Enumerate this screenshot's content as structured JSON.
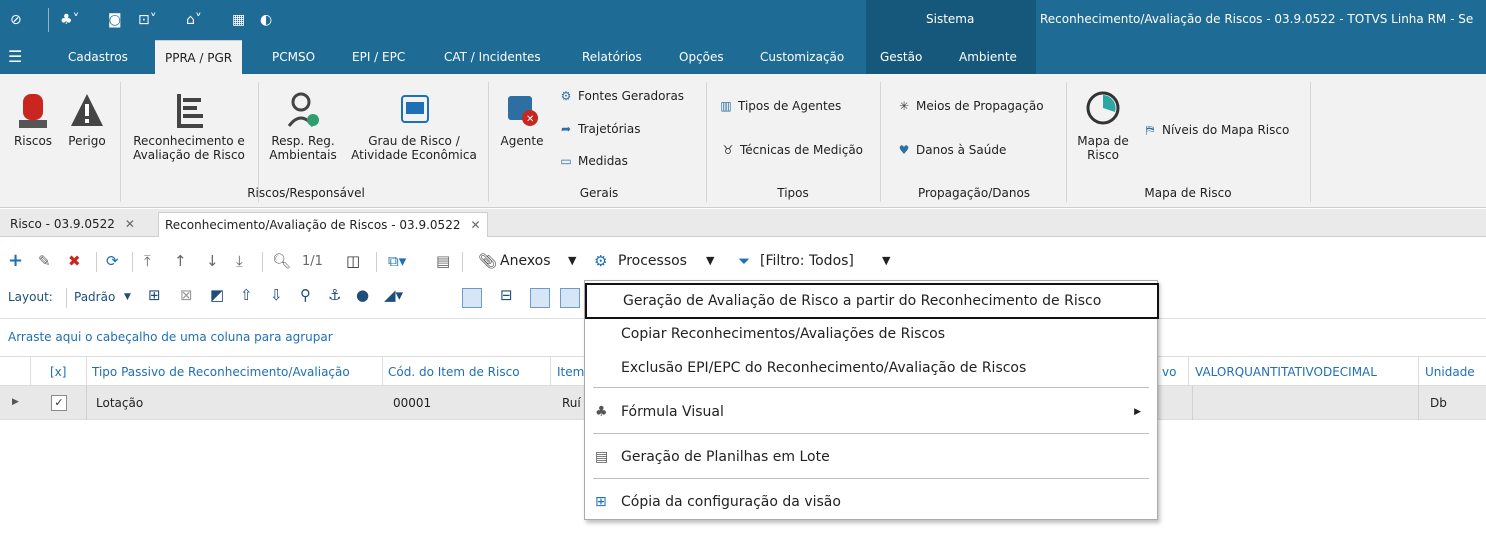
{
  "title_bar": {
    "sistema_label": "Sistema",
    "app_title": "Reconhecimento/Avaliação de Riscos - 03.9.0522 - TOTVS Linha RM - Se"
  },
  "menu": {
    "tabs": [
      "Cadastros",
      "PPRA / PGR",
      "PCMSO",
      "EPI / EPC",
      "CAT / Incidentes",
      "Relatórios",
      "Opções",
      "Customização",
      "Gestão",
      "Ambiente"
    ],
    "active": "PPRA / PGR"
  },
  "ribbon": {
    "riscos": "Riscos",
    "perigo": "Perigo",
    "reconhecimento_1": "Reconhecimento e",
    "reconhecimento_2": "Avaliação de Risco",
    "resp_1": "Resp. Reg.",
    "resp_2": "Ambientais",
    "grau_1": "Grau de Risco /",
    "grau_2": "Atividade Econômica",
    "group_riscos": "Riscos/Responsável",
    "agente": "Agente",
    "fontes": "Fontes Geradoras",
    "trajetorias": "Trajetórias",
    "medidas": "Medidas",
    "group_gerais": "Gerais",
    "tipos_agentes": "Tipos de Agentes",
    "tecnicas": "Técnicas de Medição",
    "group_tipos": "Tipos",
    "meios": "Meios de Propagação",
    "danos": "Danos à Saúde",
    "group_propagacao": "Propagação/Danos",
    "mapa_1": "Mapa de",
    "mapa_2": "Risco",
    "niveis": "Níveis do Mapa Risco",
    "group_mapa": "Mapa de Risco"
  },
  "doc_tabs": {
    "tab1": "Risco - 03.9.0522",
    "tab2": "Reconhecimento/Avaliação de Riscos - 03.9.0522"
  },
  "toolbar": {
    "page": "1/1",
    "anexos": "Anexos",
    "processos": "Processos",
    "filtro": "[Filtro: Todos]",
    "layout": "Layout:",
    "padrao": "Padrão"
  },
  "group_hint": "Arraste aqui o cabeçalho de uma coluna para agrupar",
  "grid": {
    "headers": {
      "check": "[x]",
      "tipo": "Tipo Passivo de Reconhecimento/Avaliação",
      "cod": "Cód. do Item de Risco",
      "item": "Item",
      "partial": "vo",
      "valor": "VALORQUANTITATIVODECIMAL",
      "unidade": "Unidade"
    },
    "row": {
      "tipo": "Lotação",
      "cod": "00001",
      "item": "Ruí",
      "unidade": "Db"
    }
  },
  "processos_menu": {
    "item1": "Geração de Avaliação de Risco a partir do Reconhecimento de Risco",
    "item2": "Copiar Reconhecimentos/Avaliações de Riscos",
    "item3": "Exclusão EPI/EPC do Reconhecimento/Avaliação de Riscos",
    "item4": "Fórmula Visual",
    "item5": "Geração de Planilhas em Lote",
    "item6": "Cópia da configuração da visão"
  }
}
